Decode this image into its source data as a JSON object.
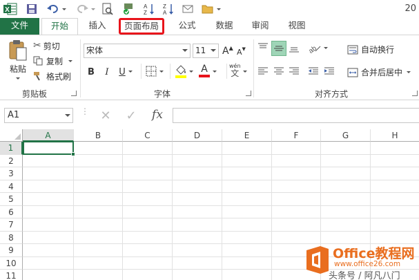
{
  "qat": {
    "title_fragment": "20"
  },
  "tabs": [
    "文件",
    "开始",
    "插入",
    "页面布局",
    "公式",
    "数据",
    "审阅",
    "视图"
  ],
  "ribbon": {
    "clipboard": {
      "paste": "粘贴",
      "cut": "剪切",
      "copy": "复制",
      "format_painter": "格式刷",
      "label": "剪贴板"
    },
    "font": {
      "font_name": "宋体",
      "font_size": "11",
      "bold": "B",
      "italic": "I",
      "underline": "U",
      "grow": "A",
      "shrink": "A",
      "font_color": "A",
      "phonetic": "wén",
      "label": "字体"
    },
    "alignment": {
      "wrap_text": "自动换行",
      "merge_center": "合并后居中",
      "label": "对齐方式"
    }
  },
  "formula_bar": {
    "name_box": "A1",
    "fx": "fx",
    "formula": ""
  },
  "grid": {
    "columns": [
      "A",
      "B",
      "C",
      "D",
      "E",
      "F",
      "G",
      "H"
    ],
    "rows": [
      "1",
      "2",
      "3",
      "4",
      "5",
      "6",
      "7",
      "8",
      "9",
      "10",
      "11"
    ],
    "active_cell": "A1"
  },
  "watermark": {
    "brand": "Office教程网",
    "url": "www.office26.com",
    "credit": "头条号 / 阿凡八门"
  },
  "colors": {
    "excel_green": "#217346",
    "highlight_red": "#e8141b",
    "active_cell_border": "#217346",
    "watermark_orange": "#e96e1f"
  }
}
